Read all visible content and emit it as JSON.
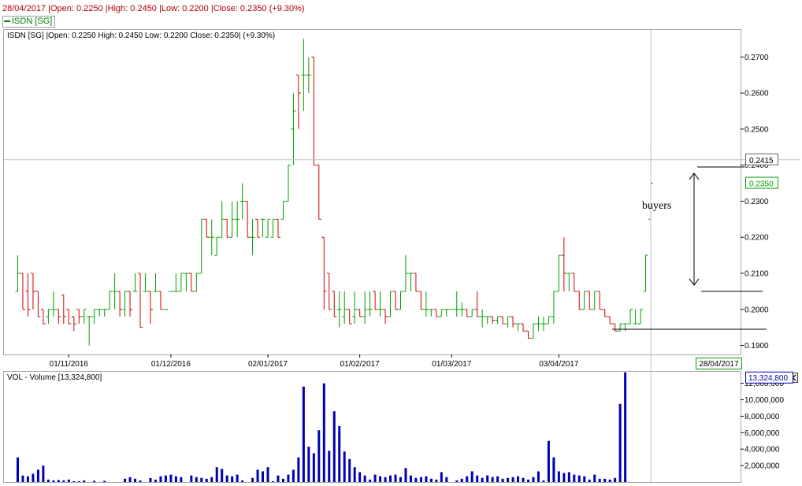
{
  "header": {
    "info_line": "28/04/2017 |Open: 0.2250 |High: 0.2450 |Low: 0.2200 |Close: 0.2350 (+9.30%)",
    "legend_label": "ISDN [SG]"
  },
  "colors": {
    "up": "#00a000",
    "down": "#d00000",
    "volume": "#0000b4",
    "frame": "#a8a8a8"
  },
  "chart_data": [
    {
      "type": "ohlc",
      "title": "ISDN [SG] |Open: 0.2250  High: 0.2450  Low: 0.2200  Close: 0.2350| (+9.30%)",
      "ylim": [
        0.1875,
        0.2775
      ],
      "y_ticks": [
        "0.1900",
        "0.2000",
        "0.2100",
        "0.2200",
        "0.2300",
        "0.2400",
        "0.2500",
        "0.2600",
        "0.2700"
      ],
      "x_ticks": [
        "01/11/2016",
        "01/12/2016",
        "02/01/2017",
        "01/02/2017",
        "01/03/2017",
        "03/04/2017"
      ],
      "x_tick_index": [
        10,
        30,
        49,
        67,
        85,
        106
      ],
      "grid": false,
      "price_labels": {
        "crosshair": "0.2415",
        "last": "0.2350"
      },
      "crosshair_value": 0.2415,
      "crosshair_date": "28/04/2017",
      "annotation": {
        "text": "buyers",
        "top_line": 0.2395,
        "mid_line": 0.205,
        "bottom_line": 0.1945
      },
      "ohlc": [
        [
          0.205,
          0.215,
          0.205,
          0.21
        ],
        [
          0.21,
          0.21,
          0.2,
          0.2
        ],
        [
          0.205,
          0.21,
          0.198,
          0.2
        ],
        [
          0.21,
          0.21,
          0.2,
          0.205
        ],
        [
          0.205,
          0.205,
          0.198,
          0.198
        ],
        [
          0.2,
          0.2,
          0.196,
          0.196
        ],
        [
          0.198,
          0.2,
          0.196,
          0.2
        ],
        [
          0.2,
          0.205,
          0.198,
          0.2
        ],
        [
          0.2,
          0.2,
          0.196,
          0.198
        ],
        [
          0.204,
          0.204,
          0.196,
          0.198
        ],
        [
          0.2,
          0.2,
          0.196,
          0.196
        ],
        [
          0.198,
          0.198,
          0.194,
          0.196
        ],
        [
          0.2,
          0.2,
          0.196,
          0.198
        ],
        [
          0.198,
          0.2,
          0.196,
          0.2
        ],
        [
          0.198,
          0.198,
          0.19,
          0.198
        ],
        [
          0.198,
          0.2,
          0.196,
          0.2
        ],
        [
          0.2,
          0.2,
          0.198,
          0.2
        ],
        [
          0.2,
          0.2,
          0.198,
          0.2
        ],
        [
          0.2,
          0.205,
          0.2,
          0.205
        ],
        [
          0.205,
          0.21,
          0.2,
          0.205
        ],
        [
          0.205,
          0.205,
          0.198,
          0.2
        ],
        [
          0.2,
          0.205,
          0.198,
          0.205
        ],
        [
          0.205,
          0.205,
          0.198,
          0.2
        ],
        [
          0.205,
          0.21,
          0.205,
          0.205
        ],
        [
          0.21,
          0.21,
          0.195,
          0.195
        ],
        [
          0.205,
          0.21,
          0.205,
          0.205
        ],
        [
          0.205,
          0.205,
          0.196,
          0.2
        ],
        [
          0.205,
          0.21,
          0.205,
          0.205
        ],
        [
          0.205,
          0.205,
          0.2,
          0.2
        ],
        [
          0.2,
          0.2,
          0.2,
          0.2
        ],
        [
          0.205,
          0.205,
          0.205,
          0.205
        ],
        [
          0.205,
          0.21,
          0.205,
          0.205
        ],
        [
          0.205,
          0.21,
          0.205,
          0.21
        ],
        [
          0.21,
          0.21,
          0.205,
          0.21
        ],
        [
          0.21,
          0.21,
          0.205,
          0.205
        ],
        [
          0.205,
          0.21,
          0.205,
          0.21
        ],
        [
          0.21,
          0.225,
          0.21,
          0.225
        ],
        [
          0.225,
          0.225,
          0.22,
          0.22
        ],
        [
          0.22,
          0.225,
          0.215,
          0.22
        ],
        [
          0.215,
          0.22,
          0.215,
          0.22
        ],
        [
          0.22,
          0.23,
          0.22,
          0.225
        ],
        [
          0.225,
          0.225,
          0.22,
          0.22
        ],
        [
          0.22,
          0.23,
          0.22,
          0.225
        ],
        [
          0.225,
          0.23,
          0.22,
          0.225
        ],
        [
          0.23,
          0.235,
          0.225,
          0.23
        ],
        [
          0.23,
          0.23,
          0.22,
          0.22
        ],
        [
          0.22,
          0.225,
          0.215,
          0.22
        ],
        [
          0.225,
          0.225,
          0.22,
          0.22
        ],
        [
          0.225,
          0.225,
          0.22,
          0.225
        ],
        [
          0.22,
          0.225,
          0.22,
          0.225
        ],
        [
          0.22,
          0.225,
          0.22,
          0.225
        ],
        [
          0.225,
          0.225,
          0.22,
          0.22
        ],
        [
          0.225,
          0.23,
          0.225,
          0.23
        ],
        [
          0.23,
          0.24,
          0.23,
          0.24
        ],
        [
          0.25,
          0.26,
          0.24,
          0.255
        ],
        [
          0.265,
          0.265,
          0.25,
          0.26
        ],
        [
          0.265,
          0.275,
          0.255,
          0.265
        ],
        [
          0.265,
          0.27,
          0.26,
          0.265
        ],
        [
          0.27,
          0.27,
          0.24,
          0.24
        ],
        [
          0.24,
          0.24,
          0.225,
          0.225
        ],
        [
          0.22,
          0.22,
          0.2,
          0.205
        ],
        [
          0.21,
          0.21,
          0.2,
          0.2
        ],
        [
          0.205,
          0.205,
          0.198,
          0.198
        ],
        [
          0.2,
          0.205,
          0.195,
          0.2
        ],
        [
          0.198,
          0.205,
          0.196,
          0.2
        ],
        [
          0.2,
          0.2,
          0.196,
          0.196
        ],
        [
          0.198,
          0.205,
          0.196,
          0.2
        ],
        [
          0.2,
          0.2,
          0.198,
          0.198
        ],
        [
          0.198,
          0.205,
          0.196,
          0.2
        ],
        [
          0.2,
          0.205,
          0.198,
          0.2
        ],
        [
          0.205,
          0.205,
          0.2,
          0.2
        ],
        [
          0.2,
          0.205,
          0.198,
          0.2
        ],
        [
          0.2,
          0.2,
          0.196,
          0.198
        ],
        [
          0.198,
          0.205,
          0.198,
          0.205
        ],
        [
          0.205,
          0.205,
          0.2,
          0.2
        ],
        [
          0.2,
          0.205,
          0.2,
          0.205
        ],
        [
          0.205,
          0.215,
          0.205,
          0.21
        ],
        [
          0.21,
          0.21,
          0.205,
          0.21
        ],
        [
          0.21,
          0.21,
          0.205,
          0.205
        ],
        [
          0.205,
          0.205,
          0.2,
          0.2
        ],
        [
          0.2,
          0.205,
          0.198,
          0.2
        ],
        [
          0.2,
          0.2,
          0.198,
          0.2
        ],
        [
          0.2,
          0.2,
          0.198,
          0.198
        ],
        [
          0.198,
          0.2,
          0.198,
          0.2
        ],
        [
          0.2,
          0.2,
          0.198,
          0.2
        ],
        [
          0.2,
          0.2,
          0.2,
          0.2
        ],
        [
          0.2,
          0.205,
          0.198,
          0.2
        ],
        [
          0.2,
          0.202,
          0.198,
          0.2
        ],
        [
          0.2,
          0.2,
          0.198,
          0.198
        ],
        [
          0.198,
          0.2,
          0.198,
          0.2
        ],
        [
          0.2,
          0.205,
          0.198,
          0.198
        ],
        [
          0.198,
          0.2,
          0.195,
          0.198
        ],
        [
          0.198,
          0.198,
          0.196,
          0.198
        ],
        [
          0.198,
          0.198,
          0.196,
          0.197
        ],
        [
          0.197,
          0.198,
          0.196,
          0.198
        ],
        [
          0.198,
          0.198,
          0.196,
          0.196
        ],
        [
          0.196,
          0.198,
          0.195,
          0.198
        ],
        [
          0.198,
          0.198,
          0.195,
          0.196
        ],
        [
          0.196,
          0.196,
          0.194,
          0.196
        ],
        [
          0.196,
          0.196,
          0.194,
          0.194
        ],
        [
          0.194,
          0.194,
          0.192,
          0.192
        ],
        [
          0.192,
          0.196,
          0.192,
          0.196
        ],
        [
          0.196,
          0.198,
          0.194,
          0.196
        ],
        [
          0.196,
          0.198,
          0.194,
          0.196
        ],
        [
          0.196,
          0.198,
          0.196,
          0.198
        ],
        [
          0.198,
          0.205,
          0.196,
          0.205
        ],
        [
          0.205,
          0.215,
          0.205,
          0.215
        ],
        [
          0.215,
          0.22,
          0.205,
          0.21
        ],
        [
          0.21,
          0.21,
          0.205,
          0.21
        ],
        [
          0.21,
          0.21,
          0.205,
          0.205
        ],
        [
          0.205,
          0.205,
          0.2,
          0.2
        ],
        [
          0.2,
          0.205,
          0.2,
          0.205
        ],
        [
          0.205,
          0.205,
          0.2,
          0.2
        ],
        [
          0.2,
          0.205,
          0.2,
          0.205
        ],
        [
          0.205,
          0.205,
          0.2,
          0.2
        ],
        [
          0.2,
          0.2,
          0.198,
          0.198
        ],
        [
          0.198,
          0.198,
          0.196,
          0.196
        ],
        [
          0.196,
          0.196,
          0.194,
          0.194
        ],
        [
          0.194,
          0.196,
          0.194,
          0.196
        ],
        [
          0.196,
          0.196,
          0.194,
          0.196
        ],
        [
          0.196,
          0.2,
          0.196,
          0.2
        ],
        [
          0.196,
          0.2,
          0.196,
          0.196
        ],
        [
          0.196,
          0.2,
          0.196,
          0.2
        ],
        [
          0.205,
          0.215,
          0.205,
          0.215
        ],
        [
          0.225,
          0.245,
          0.22,
          0.235
        ]
      ]
    },
    {
      "type": "bar",
      "title": "VOL - Volume [13,324,800]",
      "ylim": [
        0,
        13400000
      ],
      "y_ticks": [
        "2,000,000",
        "4,000,000",
        "6,000,000",
        "8,000,000",
        "10,000,000",
        "12,000,000"
      ],
      "y_tick_values": [
        2000000,
        4000000,
        6000000,
        8000000,
        10000000,
        12000000
      ],
      "last_value_label": "13,324,800",
      "values": [
        3000000,
        800000,
        700000,
        1000000,
        1500000,
        2000000,
        300000,
        200000,
        250000,
        200000,
        300000,
        100000,
        100000,
        200000,
        0,
        150000,
        0,
        150000,
        0,
        0,
        0,
        400000,
        600000,
        400000,
        200000,
        0,
        500000,
        300000,
        700000,
        800000,
        900000,
        700000,
        600000,
        0,
        800000,
        600000,
        500000,
        400000,
        600000,
        1800000,
        1600000,
        800000,
        700000,
        900000,
        200000,
        0,
        500000,
        1500000,
        1300000,
        1800000,
        100000,
        800000,
        400000,
        900000,
        1500000,
        3000000,
        11600000,
        4300000,
        3500000,
        6300000,
        12000000,
        3800000,
        8600000,
        6800000,
        3700000,
        2800000,
        1800000,
        1200000,
        800000,
        300000,
        900000,
        700000,
        600000,
        800000,
        900000,
        600000,
        1700000,
        800000,
        500000,
        600000,
        700000,
        400000,
        300000,
        1200000,
        600000,
        0,
        200000,
        400000,
        700000,
        1300000,
        800000,
        500000,
        800000,
        600000,
        700000,
        400000,
        500000,
        600000,
        700000,
        500000,
        300000,
        600000,
        1300000,
        200000,
        5000000,
        3000000,
        1300000,
        1100000,
        1200000,
        900000,
        800000,
        700000,
        300000,
        900000,
        400000,
        400000,
        300000,
        500000,
        9500000,
        13324800
      ]
    }
  ]
}
